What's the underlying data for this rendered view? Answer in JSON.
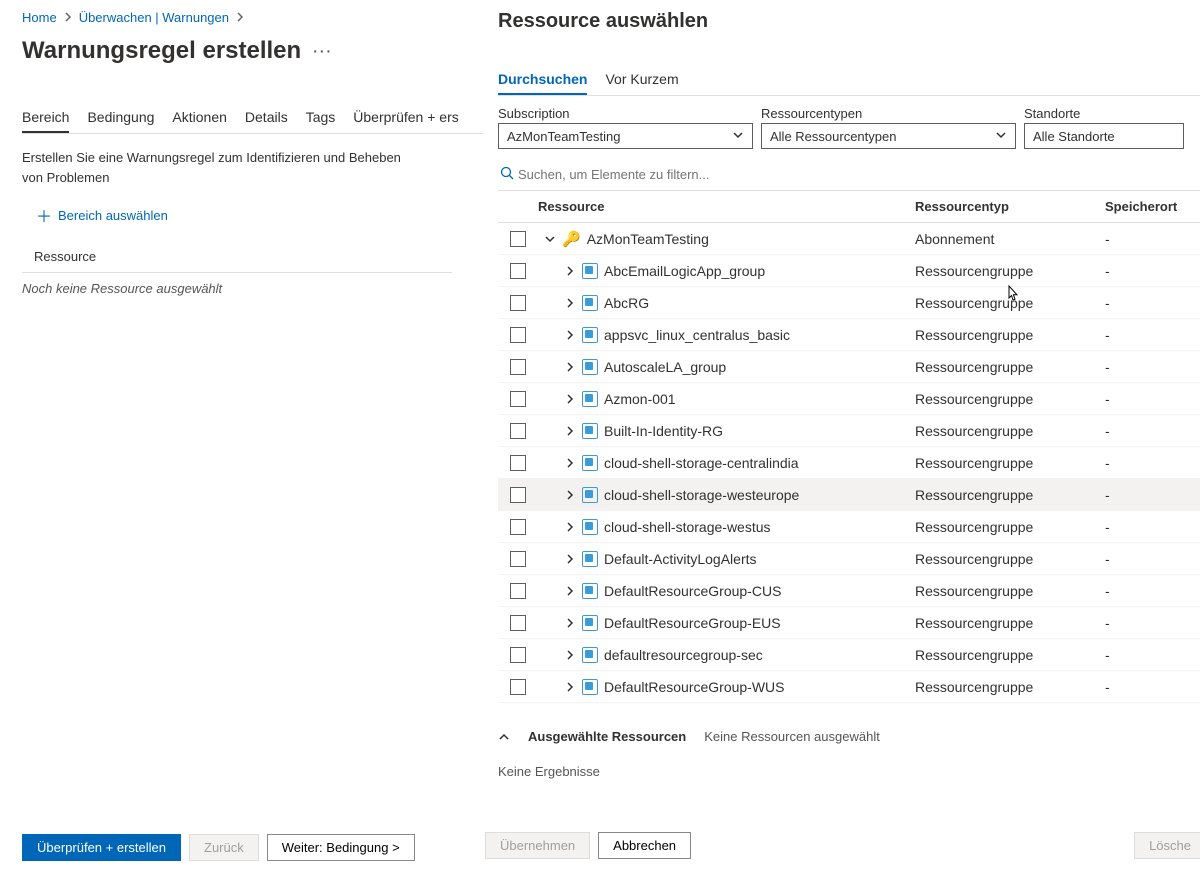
{
  "breadcrumbs": {
    "home": "Home",
    "monitor": "Überwachen | Warnungen"
  },
  "page_title": "Warnungsregel erstellen",
  "left_tabs": {
    "scope": "Bereich",
    "condition": "Bedingung",
    "actions": "Aktionen",
    "details": "Details",
    "tags": "Tags",
    "review": "Überprüfen + ers"
  },
  "desc": "Erstellen Sie eine Warnungsregel zum Identifizieren und Beheben von Problemen",
  "add_scope": "Bereich auswählen",
  "res_header": "Ressource",
  "no_res": "Noch keine Ressource ausgewählt",
  "left_buttons": {
    "review_create": "Überprüfen + erstellen",
    "back": "Zurück",
    "next": "Weiter: Bedingung >"
  },
  "panel_title": "Ressource auswählen",
  "right_tabs": {
    "browse": "Durchsuchen",
    "recent": "Vor Kurzem"
  },
  "filters": {
    "subscription": {
      "label": "Subscription",
      "value": "AzMonTeamTesting"
    },
    "types": {
      "label": "Ressourcentypen",
      "value": "Alle Ressourcentypen"
    },
    "locations": {
      "label": "Standorte",
      "value": "Alle Standorte"
    }
  },
  "search_placeholder": "Suchen, um Elemente zu filtern...",
  "columns": {
    "resource": "Ressource",
    "type": "Ressourcentyp",
    "location": "Speicherort"
  },
  "root_row": {
    "name": "AzMonTeamTesting",
    "type": "Abonnement",
    "location": "-"
  },
  "child_rows": [
    {
      "name": "AbcEmailLogicApp_group",
      "type": "Ressourcengruppe",
      "location": "-"
    },
    {
      "name": "AbcRG",
      "type": "Ressourcengruppe",
      "location": "-"
    },
    {
      "name": "appsvc_linux_centralus_basic",
      "type": "Ressourcengruppe",
      "location": "-"
    },
    {
      "name": "AutoscaleLA_group",
      "type": "Ressourcengruppe",
      "location": "-"
    },
    {
      "name": "Azmon-001",
      "type": "Ressourcengruppe",
      "location": "-"
    },
    {
      "name": "Built-In-Identity-RG",
      "type": "Ressourcengruppe",
      "location": "-"
    },
    {
      "name": "cloud-shell-storage-centralindia",
      "type": "Ressourcengruppe",
      "location": "-"
    },
    {
      "name": "cloud-shell-storage-westeurope",
      "type": "Ressourcengruppe",
      "location": "-"
    },
    {
      "name": "cloud-shell-storage-westus",
      "type": "Ressourcengruppe",
      "location": "-"
    },
    {
      "name": "Default-ActivityLogAlerts",
      "type": "Ressourcengruppe",
      "location": "-"
    },
    {
      "name": "DefaultResourceGroup-CUS",
      "type": "Ressourcengruppe",
      "location": "-"
    },
    {
      "name": "DefaultResourceGroup-EUS",
      "type": "Ressourcengruppe",
      "location": "-"
    },
    {
      "name": "defaultresourcegroup-sec",
      "type": "Ressourcengruppe",
      "location": "-"
    },
    {
      "name": "DefaultResourceGroup-WUS",
      "type": "Ressourcengruppe",
      "location": "-"
    }
  ],
  "hover_index": 7,
  "selected_section": {
    "heading": "Ausgewählte Ressourcen",
    "none": "Keine Ressourcen ausgewählt",
    "no_results": "Keine Ergebnisse"
  },
  "right_buttons": {
    "apply": "Übernehmen",
    "cancel": "Abbrechen",
    "clear": "Lösche"
  }
}
